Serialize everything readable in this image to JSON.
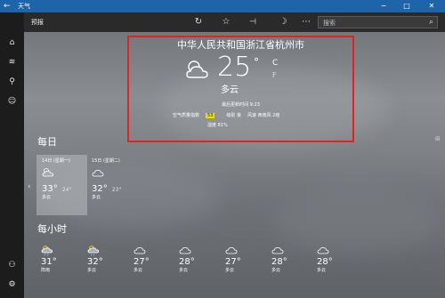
{
  "window": {
    "title": "天气"
  },
  "toolbar": {
    "section_label": "预报",
    "search_placeholder": "搜索"
  },
  "current": {
    "location": "中华人民共和国浙江省杭州市",
    "temperature": "25",
    "degree_symbol": "°",
    "unit_c": "C",
    "unit_f": "F",
    "condition": "多云",
    "updated": "最后更新时间 9:23",
    "aqi_label": "空气质量指数",
    "aqi_value": "53",
    "aqi_level": "级别 良",
    "wind": "风速 西南风 2级",
    "humidity": "湿度 81%"
  },
  "daily": {
    "heading": "每日",
    "days": [
      {
        "date": "14日 (星期一)",
        "high": "33°",
        "low": "24°",
        "desc": "多云",
        "icon": "sun-cloud-icon"
      },
      {
        "date": "15日 (星期二)",
        "high": "32°",
        "low": "23°",
        "desc": "多云",
        "icon": "cloud-icon"
      }
    ]
  },
  "hourly": {
    "heading": "每小时",
    "hours": [
      {
        "temp": "31°",
        "desc": "阵雨",
        "icon": "sun-rain-icon"
      },
      {
        "temp": "32°",
        "desc": "多云",
        "icon": "sun-rain-icon"
      },
      {
        "temp": "27°",
        "desc": "多云",
        "icon": "cloud-icon"
      },
      {
        "temp": "28°",
        "desc": "多云",
        "icon": "cloud-icon"
      },
      {
        "temp": "27°",
        "desc": "多云",
        "icon": "cloud-icon"
      },
      {
        "temp": "28°",
        "desc": "多云",
        "icon": "cloud-icon"
      },
      {
        "temp": "28°",
        "desc": "多云",
        "icon": "cloud-icon"
      }
    ]
  },
  "colors": {
    "titlebar": "#1e64a8",
    "highlight_box": "#e02424",
    "aqi_badge": "#e8e000"
  }
}
